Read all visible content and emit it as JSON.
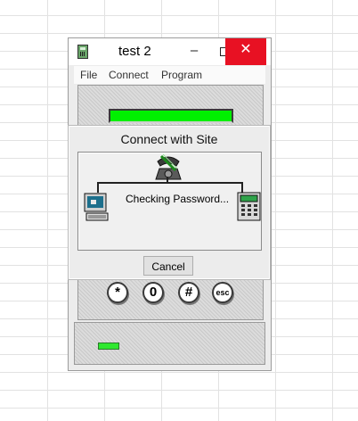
{
  "window": {
    "title": "test 2",
    "min_label": "–",
    "close_label": "✕"
  },
  "menu": {
    "items": [
      "File",
      "Connect",
      "Program"
    ]
  },
  "keypad": {
    "keys": [
      "*",
      "0",
      "#",
      "esc"
    ]
  },
  "dialog": {
    "title": "Connect with Site",
    "status_text": "Checking Password...",
    "cancel_label": "Cancel"
  },
  "colors": {
    "lcd": "#00f000",
    "close_button": "#e81123",
    "led": "#2fe82f"
  },
  "icons": {
    "app": "keypad-app-icon",
    "connection": "telephone-handset-icon",
    "computer": "computer-icon",
    "panel": "keypad-panel-icon"
  }
}
